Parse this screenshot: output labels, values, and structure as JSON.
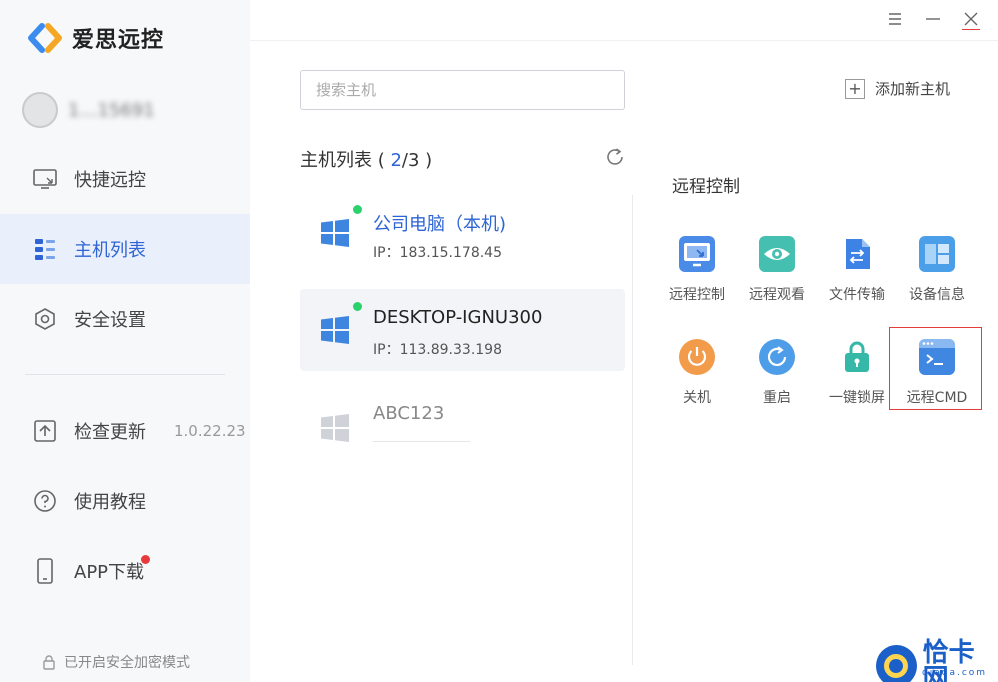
{
  "app": {
    "title": "爱思远控"
  },
  "user": {
    "account": "1…15691"
  },
  "sidebar": {
    "items": [
      {
        "label": "快捷远控",
        "icon": "monitor-icon"
      },
      {
        "label": "主机列表",
        "icon": "list-icon",
        "active": true
      },
      {
        "label": "安全设置",
        "icon": "hexagon-shield-icon"
      }
    ],
    "bottom_items": [
      {
        "label": "检查更新",
        "icon": "upload-icon",
        "extra": "1.0.22.23"
      },
      {
        "label": "使用教程",
        "icon": "help-icon"
      },
      {
        "label": "APP下载",
        "icon": "phone-icon",
        "badge": true
      }
    ],
    "secure_mode": "已开启安全加密模式"
  },
  "window_controls": [
    "menu-icon",
    "minimize-icon",
    "close-icon"
  ],
  "search": {
    "placeholder": "搜索主机",
    "value": ""
  },
  "add_host": {
    "label": "添加新主机"
  },
  "host_list": {
    "title_prefix": "主机列表 ( ",
    "online": "2",
    "separator": "/",
    "total": "3",
    "title_suffix": " )",
    "hosts": [
      {
        "name": "公司电脑（本机)",
        "ip": "IP：183.15.178.45",
        "online": true,
        "selected": false
      },
      {
        "name": "DESKTOP-IGNU300",
        "ip": "IP：113.89.33.198",
        "online": true,
        "selected": true
      },
      {
        "name": "ABC123",
        "ip": "",
        "online": false,
        "selected": false
      }
    ]
  },
  "remote_panel": {
    "title": "远程控制",
    "actions": [
      {
        "label": "远程控制",
        "icon": "remote-control-icon",
        "color": "#4a8be8"
      },
      {
        "label": "远程观看",
        "icon": "eye-icon",
        "color": "#45c0b0"
      },
      {
        "label": "文件传输",
        "icon": "file-transfer-icon",
        "color": "#3d83e6"
      },
      {
        "label": "设备信息",
        "icon": "device-info-icon",
        "color": "#4a9fe8"
      },
      {
        "label": "关机",
        "icon": "power-icon",
        "color": "#f29b4b"
      },
      {
        "label": "重启",
        "icon": "restart-icon",
        "color": "#4d9de8"
      },
      {
        "label": "一键锁屏",
        "icon": "lock-icon",
        "color": "#35b8a7"
      },
      {
        "label": "远程CMD",
        "icon": "terminal-icon",
        "color": "#3f87e0"
      }
    ]
  },
  "watermark": {
    "text": "恰卡网",
    "sub": "qiaqa.com"
  },
  "colors": {
    "accent": "#2e64d6",
    "online": "#2bd26b",
    "badge": "#e83a3a",
    "highlight": "#e53b3b"
  }
}
